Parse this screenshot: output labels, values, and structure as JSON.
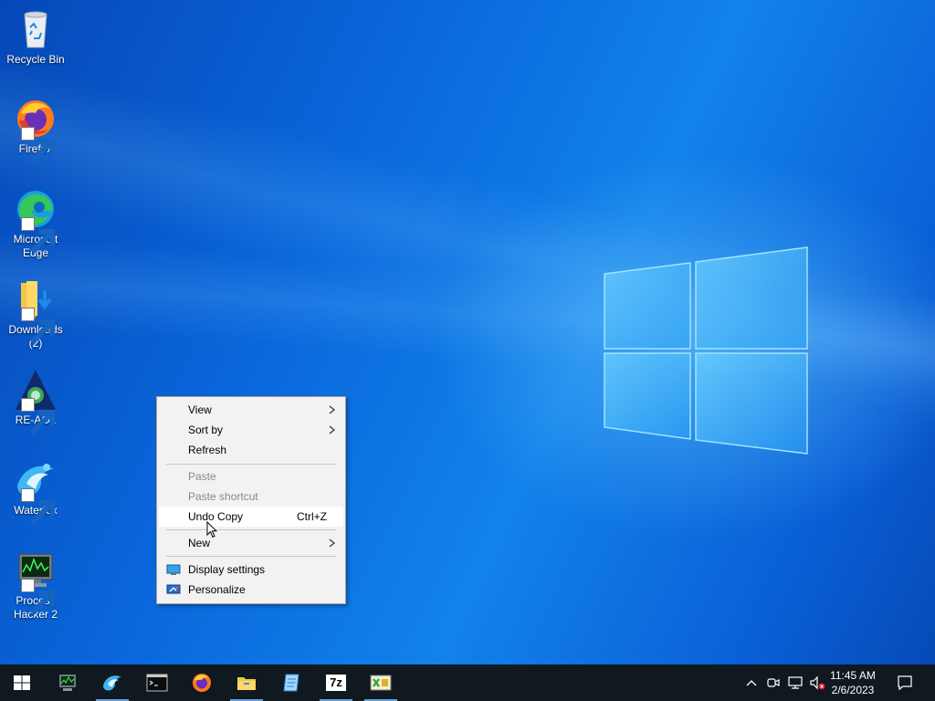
{
  "desktop": {
    "icons": [
      {
        "label": "Recycle Bin",
        "icon": "recycle-bin-icon",
        "shortcut": false
      },
      {
        "label": "Firefox",
        "icon": "firefox-icon",
        "shortcut": true
      },
      {
        "label": "Microsoft Edge",
        "icon": "edge-icon",
        "shortcut": true
      },
      {
        "label": "Downloads (2)",
        "icon": "folder-download-icon",
        "shortcut": true
      },
      {
        "label": "RE-AOL",
        "icon": "re-aol-icon",
        "shortcut": true
      },
      {
        "label": "Waterfox",
        "icon": "waterfox-icon",
        "shortcut": true
      },
      {
        "label": "Process Hacker 2",
        "icon": "process-hacker-icon",
        "shortcut": true
      }
    ]
  },
  "context_menu": {
    "view": "View",
    "sort_by": "Sort by",
    "refresh": "Refresh",
    "paste": "Paste",
    "paste_shortcut": "Paste shortcut",
    "undo_copy": "Undo Copy",
    "undo_copy_shortcut": "Ctrl+Z",
    "new": "New",
    "display_settings": "Display settings",
    "personalize": "Personalize"
  },
  "taskbar": {
    "apps": [
      "start-icon",
      "process-hacker-icon",
      "waterfox-icon",
      "terminal-icon",
      "firefox-icon",
      "file-explorer-icon",
      "notepad-icon",
      "7zip-icon",
      "pixel-editor-icon"
    ],
    "seven_zip_text": "7z",
    "clock": {
      "time": "11:45 AM",
      "date": "2/6/2023"
    }
  },
  "colors": {
    "accent": "#0a63d8",
    "taskbar": "#101820"
  }
}
